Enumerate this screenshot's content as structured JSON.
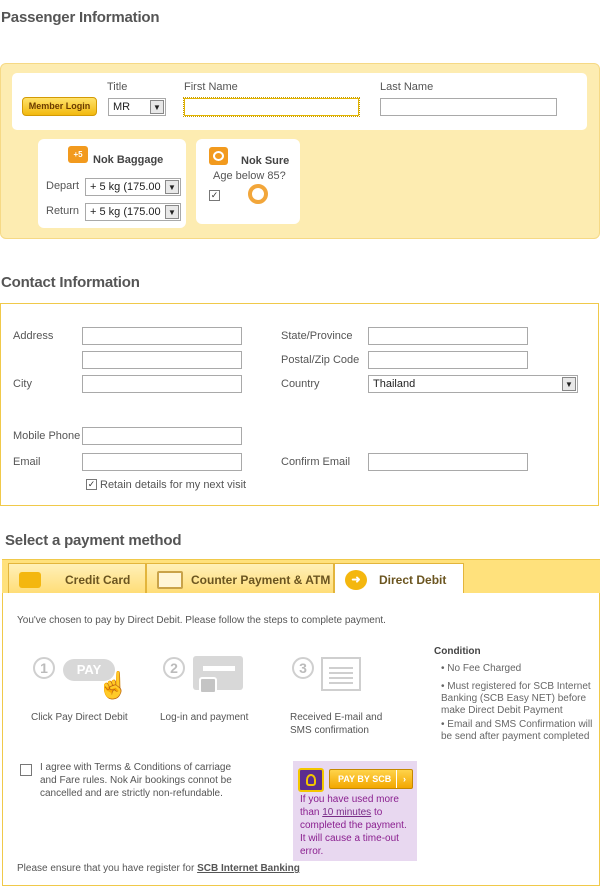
{
  "passenger": {
    "title": "Passenger Information",
    "member_login": "Member Login",
    "title_label": "Title",
    "title_value": "MR",
    "first_name_label": "First Name",
    "last_name_label": "Last Name",
    "first_name_value": "",
    "last_name_value": ""
  },
  "baggage": {
    "title": "Nok Baggage",
    "depart_label": "Depart",
    "depart_value": "+ 5 kg (175.00",
    "return_label": "Return",
    "return_value": "+ 5 kg (175.00"
  },
  "nok_sure": {
    "title": "Nok Sure",
    "subtitle": "Age below 85?",
    "checked": true
  },
  "contact": {
    "title": "Contact Information",
    "address_label": "Address",
    "city_label": "City",
    "mobile_label": "Mobile Phone",
    "email_label": "Email",
    "state_label": "State/Province",
    "postal_label": "Postal/Zip Code",
    "country_label": "Country",
    "country_value": "Thailand",
    "confirm_email_label": "Confirm Email",
    "retain_label": "Retain details for my next visit",
    "retain_checked": true
  },
  "payment": {
    "title": "Select a payment method",
    "tabs": [
      {
        "label": "Credit Card",
        "active": false
      },
      {
        "label": "Counter Payment & ATM",
        "active": false
      },
      {
        "label": "Direct Debit",
        "active": true
      }
    ],
    "intro": "You've chosen to pay by Direct Debit. Please follow the steps to complete payment.",
    "steps": [
      {
        "num": "1",
        "label": "Click Pay Direct Debit",
        "icon_text": "PAY"
      },
      {
        "num": "2",
        "label": "Log-in and payment"
      },
      {
        "num": "3",
        "label_line1": "Received E-mail and",
        "label_line2": "SMS confirmation"
      }
    ],
    "condition_title": "Condition",
    "conditions": [
      "No Fee Charged",
      "Must registered for SCB Internet Banking (SCB Easy NET) before make Direct Debit Payment",
      "Email and SMS Confirmation will be send after payment completed"
    ],
    "agree_line1": "I agree with Terms & Conditions of carriage",
    "agree_line2": "and Fare rules. Nok Air bookings connot be",
    "agree_line3": "cancelled and are strictly non-refundable.",
    "pay_button": "PAY BY SCB",
    "warn_pre": "If you have used more than ",
    "warn_link": "10 minutes",
    "warn_post": " to completed the payment. It will cause a time-out error.",
    "footer_pre": "Please ensure that you have register for ",
    "footer_link": "SCB Internet Banking"
  },
  "colors": {
    "panel": "#fdecb1",
    "accent": "#f0c94a",
    "scb_purple": "#5b2d8f",
    "warn": "#8a1f8f"
  }
}
